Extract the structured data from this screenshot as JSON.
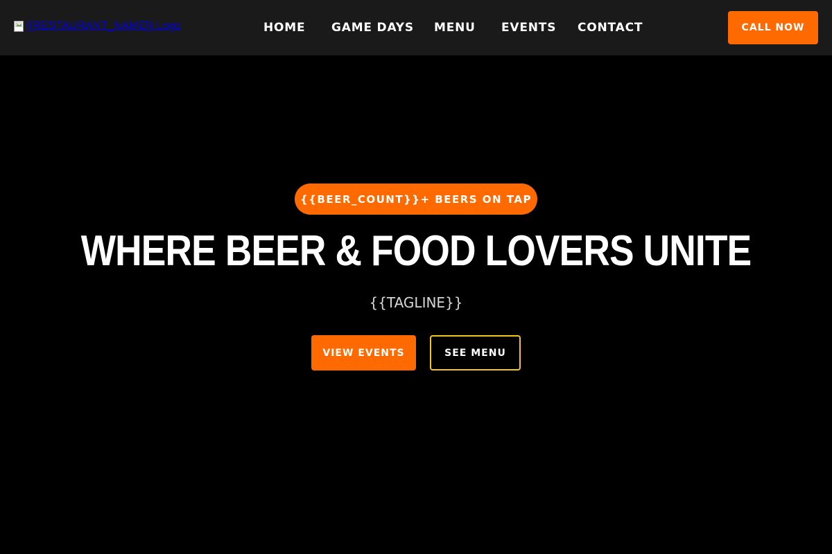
{
  "header": {
    "logo_alt": "{{RESTAURANT_NAME}} Logo",
    "nav": [
      {
        "label": "HOME"
      },
      {
        "label": "GAME DAYS"
      },
      {
        "label": "MENU"
      },
      {
        "label": "EVENTS"
      },
      {
        "label": "CONTACT"
      }
    ],
    "call_button": "CALL NOW"
  },
  "hero": {
    "badge": "{{BEER_COUNT}}+ BEERS ON TAP",
    "headline": "WHERE BEER & FOOD LOVERS UNITE",
    "tagline": "{{TAGLINE}}",
    "primary_button": "VIEW EVENTS",
    "secondary_button": "SEE MENU"
  },
  "colors": {
    "header_bg": "#1a1a1a",
    "page_bg": "#000000",
    "accent": "#ff6a00",
    "outline": "#f5c518",
    "text": "#ffffff"
  },
  "icons": {
    "logo": "broken-image-icon"
  }
}
